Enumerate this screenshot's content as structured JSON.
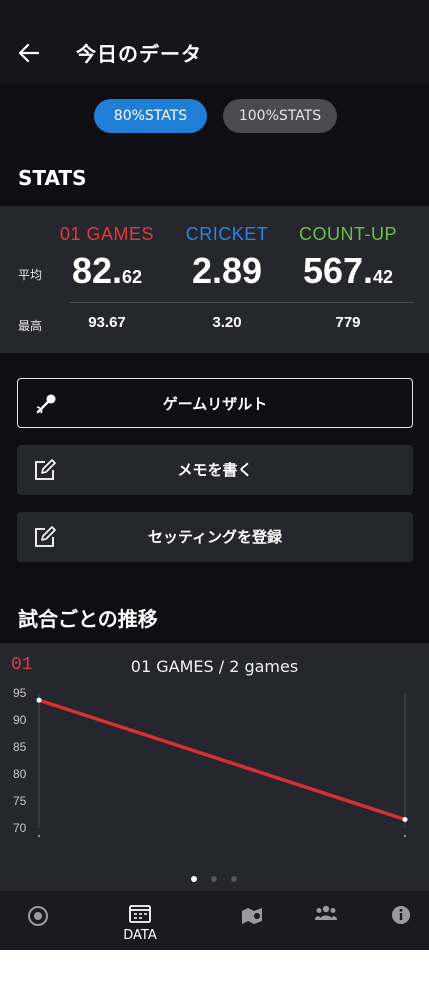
{
  "header": {
    "title": "今日のデータ"
  },
  "toggle": {
    "option_80": "80%STATS",
    "option_100": "100%STATS",
    "selected": "80%STATS"
  },
  "stats": {
    "section_title": "STATS",
    "row_labels": {
      "average": "平均",
      "max": "最高"
    },
    "columns": [
      {
        "name": "01 GAMES",
        "color": "#e03a3a",
        "avg_int": "82.",
        "avg_dec": "62",
        "max": "93.67"
      },
      {
        "name": "CRICKET",
        "color": "#2a86e0",
        "avg_int": "2.89",
        "avg_dec": "",
        "max": "3.20"
      },
      {
        "name": "COUNT-UP",
        "color": "#6cc04a",
        "avg_int": "567.",
        "avg_dec": "42",
        "max": "779"
      }
    ]
  },
  "actions": [
    {
      "label": "ゲームリザルト",
      "icon": "dart-icon"
    },
    {
      "label": "メモを書く",
      "icon": "edit-icon"
    },
    {
      "label": "セッティングを登録",
      "icon": "edit-icon"
    }
  ],
  "trend": {
    "section_title": "試合ごとの推移",
    "icon_text": "01",
    "chart_title": "01 GAMES / 2 games",
    "page_dots": 3,
    "active_dot": 0
  },
  "chart_data": {
    "type": "line",
    "title": "01 GAMES / 2 games",
    "xlabel": "",
    "ylabel": "",
    "x": [
      1,
      2
    ],
    "series": [
      {
        "values": [
          93.67,
          71.57
        ],
        "color": "#d63031"
      }
    ],
    "yticks": [
      "95",
      "90",
      "85",
      "80",
      "75",
      "70"
    ],
    "ylim": [
      70,
      95
    ],
    "grid": false,
    "legend": "none"
  },
  "nav": {
    "items": [
      {
        "icon": "dartboard-icon",
        "label": ""
      },
      {
        "icon": "data-icon",
        "label": "DATA",
        "active": true
      },
      {
        "icon": "map-icon",
        "label": ""
      },
      {
        "icon": "friends-icon",
        "label": ""
      },
      {
        "icon": "info-icon",
        "label": ""
      }
    ]
  }
}
